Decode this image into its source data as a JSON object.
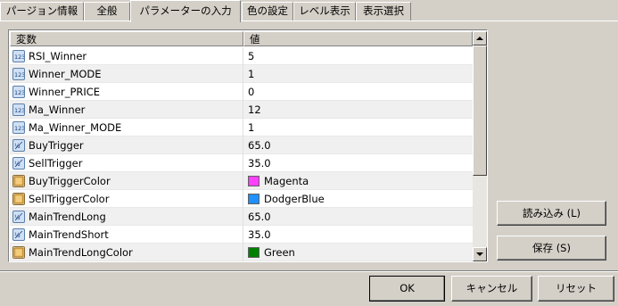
{
  "tabs": [
    {
      "label": "パージョン情報",
      "active": false
    },
    {
      "label": "全般",
      "active": false
    },
    {
      "label": "パラメーターの入力",
      "active": true
    },
    {
      "label": "色の設定",
      "active": false
    },
    {
      "label": "レベル表示",
      "active": false
    },
    {
      "label": "表示選択",
      "active": false
    }
  ],
  "grid": {
    "headers": {
      "name": "変数",
      "value": "値"
    },
    "rows": [
      {
        "icon": "int-icon",
        "name": "RSI_Winner",
        "value": "5"
      },
      {
        "icon": "int-icon",
        "name": "Winner_MODE",
        "value": "1"
      },
      {
        "icon": "int-icon",
        "name": "Winner_PRICE",
        "value": "0"
      },
      {
        "icon": "int-icon",
        "name": "Ma_Winner",
        "value": "12"
      },
      {
        "icon": "int-icon",
        "name": "Ma_Winner_MODE",
        "value": "1"
      },
      {
        "icon": "double-icon",
        "name": "BuyTrigger",
        "value": "65.0"
      },
      {
        "icon": "double-icon",
        "name": "SellTrigger",
        "value": "35.0"
      },
      {
        "icon": "color-icon",
        "name": "BuyTriggerColor",
        "value": "Magenta",
        "swatch": "#ff40ff"
      },
      {
        "icon": "color-icon",
        "name": "SellTriggerColor",
        "value": "DodgerBlue",
        "swatch": "#1e90ff"
      },
      {
        "icon": "double-icon",
        "name": "MainTrendLong",
        "value": "65.0"
      },
      {
        "icon": "double-icon",
        "name": "MainTrendShort",
        "value": "35.0"
      },
      {
        "icon": "color-icon",
        "name": "MainTrendLongColor",
        "value": "Green",
        "swatch": "#008000"
      }
    ]
  },
  "buttons": {
    "load": {
      "label": "読み込み",
      "accel": "(L)"
    },
    "save": {
      "label": "保存",
      "accel": "(S)"
    },
    "ok": "OK",
    "cancel": "キャンセル",
    "reset": "リセット"
  },
  "colors": {
    "face": "#d4d0c8",
    "alt_row": "#f0f0f0"
  }
}
